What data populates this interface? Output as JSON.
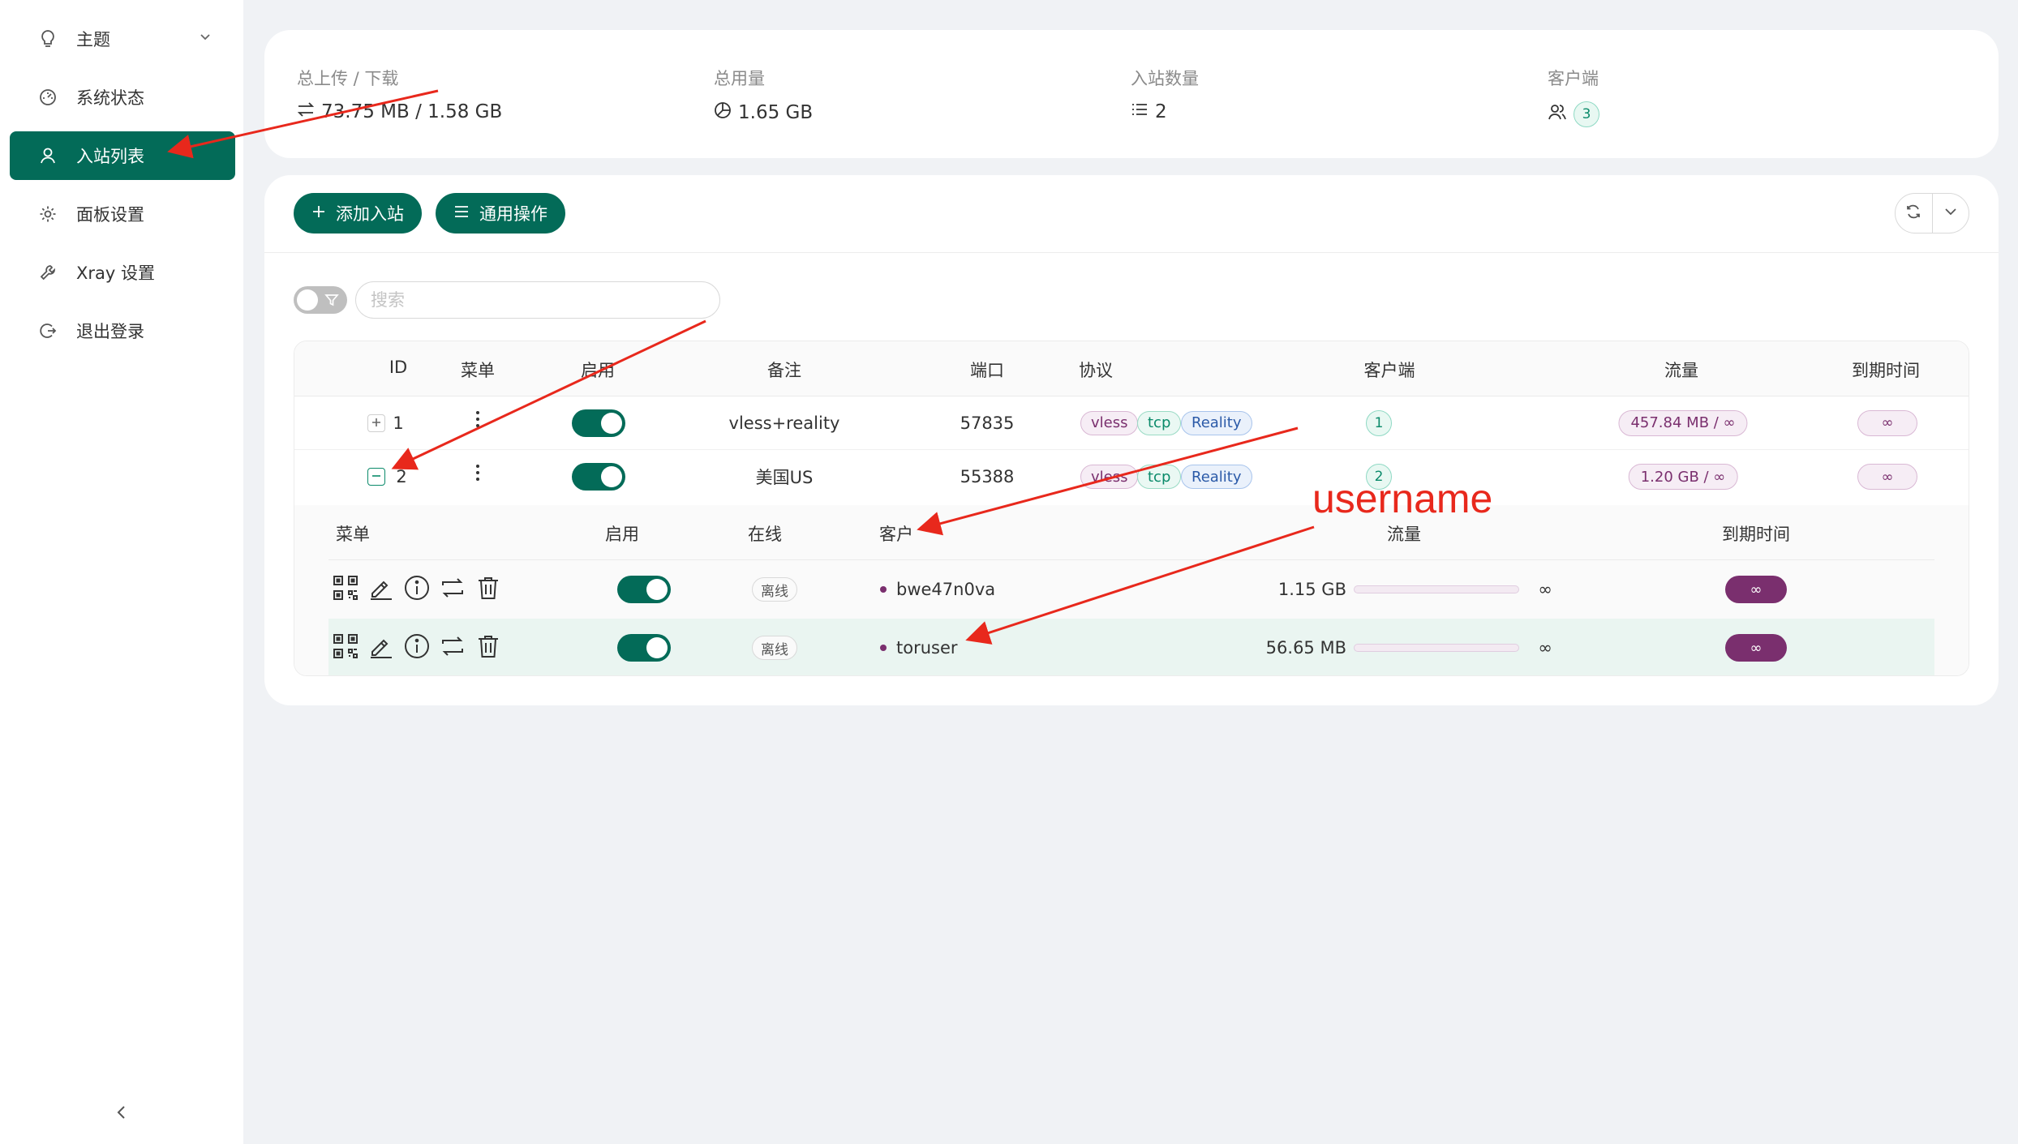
{
  "sidebar": {
    "items": [
      {
        "label": "主题",
        "icon": "bulb-icon"
      },
      {
        "label": "系统状态",
        "icon": "dashboard-icon"
      },
      {
        "label": "入站列表",
        "icon": "user-icon",
        "active": true
      },
      {
        "label": "面板设置",
        "icon": "gear-icon"
      },
      {
        "label": "Xray 设置",
        "icon": "tool-icon"
      },
      {
        "label": "退出登录",
        "icon": "logout-icon"
      }
    ]
  },
  "stats": {
    "upload_download": {
      "label": "总上传 / 下载",
      "value": "73.75 MB / 1.58 GB"
    },
    "total_usage": {
      "label": "总用量",
      "value": "1.65 GB"
    },
    "inbound_count": {
      "label": "入站数量",
      "value": "2"
    },
    "clients": {
      "label": "客户端",
      "value": "3"
    }
  },
  "toolbar": {
    "add_inbound": "添加入站",
    "general_actions": "通用操作"
  },
  "search": {
    "placeholder": "搜索"
  },
  "table": {
    "headers": {
      "id": "ID",
      "menu": "菜单",
      "enable": "启用",
      "remark": "备注",
      "port": "端口",
      "protocol": "协议",
      "clients": "客户端",
      "traffic": "流量",
      "expiry": "到期时间"
    },
    "rows": [
      {
        "id": "1",
        "remark": "vless+reality",
        "port": "57835",
        "tags": [
          "vless",
          "tcp",
          "Reality"
        ],
        "clients": "1",
        "traffic": "457.84 MB / ∞",
        "expiry": "∞"
      },
      {
        "id": "2",
        "remark": "美国US",
        "port": "55388",
        "tags": [
          "vless",
          "tcp",
          "Reality"
        ],
        "clients": "2",
        "traffic": "1.20 GB / ∞",
        "expiry": "∞"
      }
    ]
  },
  "clients_table": {
    "headers": {
      "menu": "菜单",
      "enable": "启用",
      "online": "在线",
      "client": "客户",
      "traffic": "流量",
      "expiry": "到期时间"
    },
    "rows": [
      {
        "status": "离线",
        "name": "bwe47n0va",
        "traffic": "1.15 GB",
        "limit": "∞",
        "expiry": "∞"
      },
      {
        "status": "离线",
        "name": "toruser",
        "traffic": "56.65 MB",
        "limit": "∞",
        "expiry": "∞"
      }
    ]
  },
  "annotation": {
    "text": "username",
    "color": "#e8281c"
  },
  "colors": {
    "primary": "#036b58",
    "accent_purple": "#7a2f6e"
  }
}
